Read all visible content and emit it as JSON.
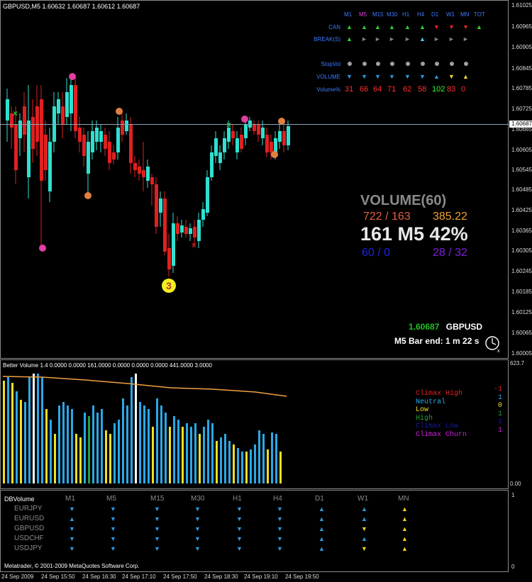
{
  "main": {
    "title": "GBPUSD,M5  1.60632 1.60687 1.60612 1.60687",
    "price_labels": [
      "1.61025",
      "1.60965",
      "1.60905",
      "1.60845",
      "1.60785",
      "1.60725",
      "1.60687",
      "1.60665",
      "1.60605",
      "1.60545",
      "1.60485",
      "1.60425",
      "1.60365",
      "1.60305",
      "1.60245",
      "1.60185",
      "1.60125",
      "1.60065",
      "1.60005"
    ],
    "current_price": "1.60687",
    "pair": "GBPUSD",
    "bar_end_label": "M5 Bar end: 1 m 22 s",
    "signal_label": "3"
  },
  "matrix": {
    "timeframes": [
      "M1",
      "M5",
      "M15",
      "M30",
      "H1",
      "H4",
      "D1",
      "W1",
      "MN",
      "TOT"
    ],
    "rows": [
      {
        "label": "CAN",
        "arrows": [
          "up-green",
          "up-green",
          "up-green",
          "up-green",
          "up-green",
          "up-green",
          "down-red",
          "down-red",
          "down-red",
          "up-green"
        ]
      },
      {
        "label": "BREAK(S)",
        "arrows": [
          "up-green",
          "right-gray",
          "right-gray",
          "right-gray",
          "right-gray",
          "up-cyan",
          "right-gray",
          "right-gray",
          "right-gray",
          ""
        ]
      },
      {
        "label": "StopVol",
        "dots": 9
      },
      {
        "label": "VOLUME",
        "arrows": [
          "down-blue",
          "down-blue",
          "down-blue",
          "down-blue",
          "down-blue",
          "down-blue",
          "up-blue",
          "down-yellow",
          "up-yellow",
          ""
        ]
      },
      {
        "label": "Volume%",
        "values": [
          "31",
          "66",
          "64",
          "71",
          "62",
          "58",
          "102",
          "83",
          "0"
        ],
        "colors": [
          "#ff3030",
          "#ff3030",
          "#ff3030",
          "#ff3030",
          "#ff3030",
          "#ff3030",
          "#30ff30",
          "#ff3030",
          "#ff3030"
        ]
      }
    ]
  },
  "volume_box": {
    "title": "VOLUME(60)",
    "ratio1": "722 / 163",
    "value1": "385.22",
    "headline": "161 M5 42%",
    "ratio2": "60 / 0",
    "ratio3": "28 / 32"
  },
  "sub": {
    "title": "Better Volume 1.4 0.0000 0.0000 161.0000 0.0000 0.0000 0.0000 441.0000 3.0000",
    "top_value": "623.7",
    "bottom_value": "0.00",
    "legend": [
      {
        "label": "Climax High",
        "value": "-1",
        "color": "#e02020"
      },
      {
        "label": "Neutral",
        "value": "1",
        "color": "#29a8e8"
      },
      {
        "label": "Low",
        "value": "0",
        "color": "#f0e020"
      },
      {
        "label": "High",
        "value": "1",
        "color": "#20a040"
      },
      {
        "label": "Climax Low",
        "value": "1",
        "color": "#1b1b9a"
      },
      {
        "label": "Climax Churn",
        "value": "1",
        "color": "#d020e0"
      }
    ]
  },
  "dbv": {
    "title": "DBVolume",
    "timeframes": [
      "M1",
      "M5",
      "M15",
      "M30",
      "H1",
      "H4",
      "D1",
      "W1",
      "MN"
    ],
    "pairs": [
      "EURJPY",
      "EURUSD",
      "GBPUSD",
      "USDCHF",
      "USDJPY"
    ],
    "right_top": "1",
    "right_bottom": "0",
    "copyright": "Metatrader, © 2001-2009 MetaQuotes Software Corp."
  },
  "time_axis": [
    "24 Sep 2009",
    "24 Sep 15:50",
    "24 Sep 16:30",
    "24 Sep 17:10",
    "24 Sep 17:50",
    "24 Sep 18:30",
    "24 Sep 19:10",
    "24 Sep 19:50"
  ],
  "colors": {
    "bull": "#2ee0d0",
    "bear": "#e02020",
    "axis_text": "#dcdcdc",
    "grid_blue": "#3b7bff",
    "gray_frame": "#8a8a8a"
  }
}
